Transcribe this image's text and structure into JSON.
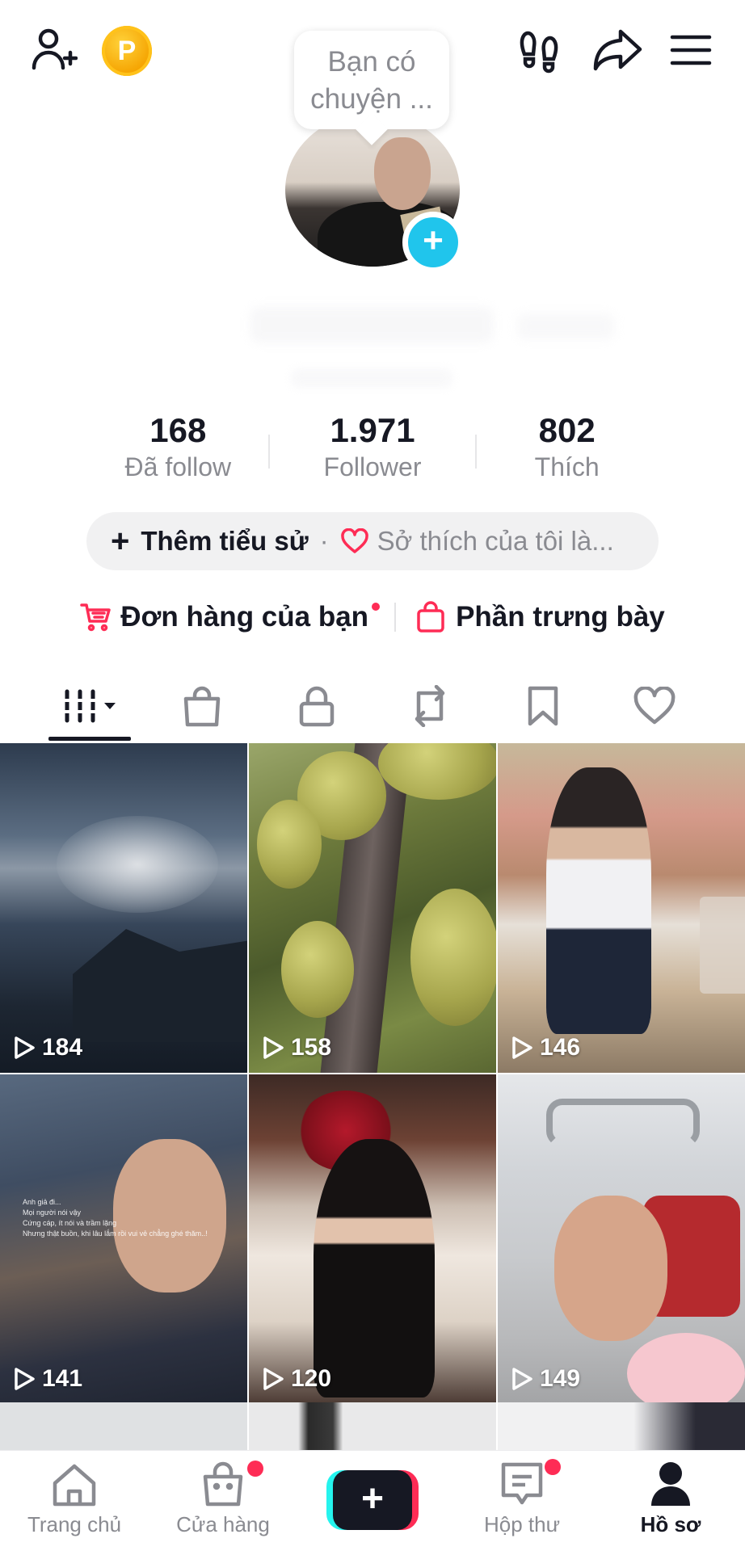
{
  "topbar": {
    "coin_label": "P",
    "icons": [
      "add-friend-icon",
      "coin-icon",
      "footsteps-icon",
      "share-icon",
      "menu-icon"
    ]
  },
  "profile": {
    "status_bubble": [
      "Bạn có",
      "chuyện ..."
    ],
    "stats": [
      {
        "value": "168",
        "label": "Đã follow"
      },
      {
        "value": "1.971",
        "label": "Follower"
      },
      {
        "value": "802",
        "label": "Thích"
      }
    ],
    "bio": {
      "add_label": "Thêm tiểu sử",
      "separator": "·",
      "hobby_label": "Sở thích của tôi là..."
    },
    "shop": {
      "orders_label": "Đơn hàng của bạn",
      "showcase_label": "Phần trưng bày"
    }
  },
  "tabs": [
    {
      "name": "videos",
      "icon": "grid-icon",
      "active": true
    },
    {
      "name": "shop",
      "icon": "shopping-bag-icon",
      "active": false
    },
    {
      "name": "private",
      "icon": "lock-icon",
      "active": false
    },
    {
      "name": "reposts",
      "icon": "repost-icon",
      "active": false
    },
    {
      "name": "favorites",
      "icon": "bookmark-icon",
      "active": false
    },
    {
      "name": "liked",
      "icon": "heart-icon",
      "active": false
    }
  ],
  "videos": [
    {
      "views": "184"
    },
    {
      "views": "158"
    },
    {
      "views": "146"
    },
    {
      "views": "141",
      "overlay_text": [
        "Anh giả đi...",
        "Mọi người nói vậy",
        "Cứng cáp, ít nói và trầm lặng",
        "Nhưng thật buồn, khi lâu lắm rồi vui vẻ chẳng ghé thăm..!"
      ]
    },
    {
      "views": "120"
    },
    {
      "views": "149"
    }
  ],
  "bottom_nav": [
    {
      "label": "Trang chủ",
      "icon": "home-icon",
      "badge": false,
      "active": false
    },
    {
      "label": "Cửa hàng",
      "icon": "shop-icon",
      "badge": true,
      "active": false
    },
    {
      "label": "",
      "icon": "plus-icon",
      "badge": false,
      "active": false
    },
    {
      "label": "Hộp thư",
      "icon": "inbox-icon",
      "badge": true,
      "active": false
    },
    {
      "label": "Hồ sơ",
      "icon": "profile-icon",
      "badge": false,
      "active": true
    }
  ],
  "colors": {
    "accent": "#fe2c55",
    "cyan": "#20c5ec",
    "text": "#161823",
    "muted": "#8a8b91"
  }
}
